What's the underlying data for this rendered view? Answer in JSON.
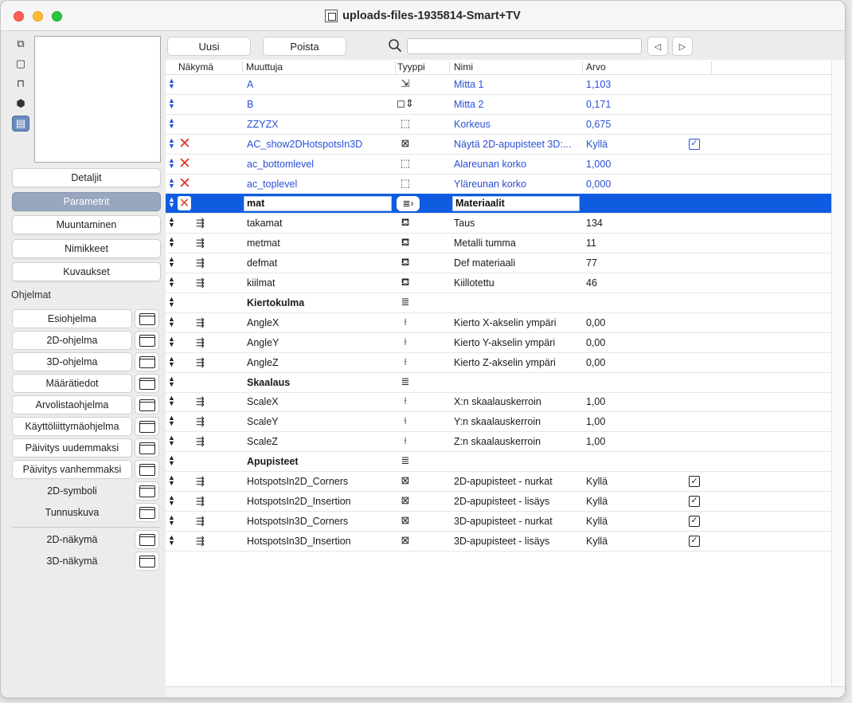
{
  "window": {
    "title": "uploads-files-1935814-Smart+TV"
  },
  "side_icons": [
    "copy-icon",
    "square-icon",
    "floor-plan-icon",
    "cube-icon",
    "list-panel-icon"
  ],
  "nav": {
    "buttons": [
      {
        "label": "Detaljit"
      },
      {
        "label": "Parametrit"
      },
      {
        "label": "Muuntaminen"
      },
      {
        "label": "Nimikkeet"
      },
      {
        "label": "Kuvaukset"
      }
    ]
  },
  "programs": {
    "label": "Ohjelmat",
    "items": [
      {
        "label": "Esiohjelma"
      },
      {
        "label": "2D-ohjelma"
      },
      {
        "label": "3D-ohjelma"
      },
      {
        "label": "Määrätiedot"
      },
      {
        "label": "Arvolistaohjelma"
      },
      {
        "label": "Käyttöliittymäohjelma"
      },
      {
        "label": "Päivitys uudemmaksi"
      },
      {
        "label": "Päivitys vanhemmaksi"
      },
      {
        "label": "2D-symboli"
      },
      {
        "label": "Tunnuskuva"
      }
    ],
    "views": [
      {
        "label": "2D-näkymä"
      },
      {
        "label": "3D-näkymä"
      }
    ]
  },
  "toolbar": {
    "new_label": "Uusi",
    "delete_label": "Poista",
    "search_placeholder": "",
    "prev_label": "◁",
    "next_label": "▷"
  },
  "table": {
    "headers": {
      "view": "Näkymä",
      "variable": "Muuttuja",
      "type": "Tyyppi",
      "name": "Nimi",
      "value": "Arvo"
    },
    "rows": [
      {
        "var": "A",
        "type_icon": "⇲",
        "name": "Mitta 1",
        "value": "1,103",
        "style": "blue"
      },
      {
        "var": "B",
        "type_icon": "◻⇕",
        "name": "Mitta 2",
        "value": "0,171",
        "style": "blue"
      },
      {
        "var": "ZZYZX",
        "type_icon": "⬚",
        "name": "Korkeus",
        "value": "0,675",
        "style": "blue"
      },
      {
        "var": "AC_show2DHotspotsIn3D",
        "type_icon": "⊠",
        "name": "Näytä 2D-apupisteet 3D:...",
        "value": "Kyllä",
        "style": "blue",
        "x": true,
        "check": "blue"
      },
      {
        "var": "ac_bottomlevel",
        "type_icon": "⬚",
        "name": "Alareunan korko",
        "value": "1,000",
        "style": "blue",
        "x": true
      },
      {
        "var": "ac_toplevel",
        "type_icon": "⬚",
        "name": "Yläreunan korko",
        "value": "0,000",
        "style": "blue",
        "x": true
      },
      {
        "var": "mat",
        "type_icon": "≣›",
        "name": "Materiaalit",
        "value": "",
        "style": "selected",
        "x": true
      },
      {
        "var": "takamat",
        "type_icon": "⛾",
        "name": "Taus",
        "value": "134",
        "style": "child"
      },
      {
        "var": "metmat",
        "type_icon": "⛾",
        "name": "Metalli tumma",
        "value": "11",
        "style": "child"
      },
      {
        "var": "defmat",
        "type_icon": "⛾",
        "name": "Def materiaali",
        "value": "77",
        "style": "child"
      },
      {
        "var": "kiilmat",
        "type_icon": "⛾",
        "name": "Kiillotettu",
        "value": "46",
        "style": "child"
      },
      {
        "var": "Kiertokulma",
        "type_icon": "≣",
        "name": "",
        "value": "",
        "style": "group"
      },
      {
        "var": "AngleX",
        "type_icon": "⟊",
        "name": "Kierto X-akselin ympäri",
        "value": "0,00",
        "style": "child"
      },
      {
        "var": "AngleY",
        "type_icon": "⟊",
        "name": "Kierto Y-akselin ympäri",
        "value": "0,00",
        "style": "child"
      },
      {
        "var": "AngleZ",
        "type_icon": "⟊",
        "name": "Kierto Z-akselin ympäri",
        "value": "0,00",
        "style": "child"
      },
      {
        "var": "Skaalaus",
        "type_icon": "≣",
        "name": "",
        "value": "",
        "style": "group"
      },
      {
        "var": "ScaleX",
        "type_icon": "⟊",
        "name": "X:n skaalauskerroin",
        "value": "1,00",
        "style": "child"
      },
      {
        "var": "ScaleY",
        "type_icon": "⟊",
        "name": "Y:n skaalauskerroin",
        "value": "1,00",
        "style": "child"
      },
      {
        "var": "ScaleZ",
        "type_icon": "⟊",
        "name": "Z:n skaalauskerroin",
        "value": "1,00",
        "style": "child"
      },
      {
        "var": "Apupisteet",
        "type_icon": "≣",
        "name": "",
        "value": "",
        "style": "group"
      },
      {
        "var": "HotspotsIn2D_Corners",
        "type_icon": "⊠",
        "name": "2D-apupisteet - nurkat",
        "value": "Kyllä",
        "style": "child",
        "check": "dark"
      },
      {
        "var": "HotspotsIn2D_Insertion",
        "type_icon": "⊠",
        "name": "2D-apupisteet - lisäys",
        "value": "Kyllä",
        "style": "child",
        "check": "dark"
      },
      {
        "var": "HotspotsIn3D_Corners",
        "type_icon": "⊠",
        "name": "3D-apupisteet - nurkat",
        "value": "Kyllä",
        "style": "child",
        "check": "dark"
      },
      {
        "var": "HotspotsIn3D_Insertion",
        "type_icon": "⊠",
        "name": "3D-apupisteet - lisäys",
        "value": "Kyllä",
        "style": "child",
        "check": "dark"
      }
    ]
  },
  "colors": {
    "selection": "#0f5ce0",
    "link_blue": "#2b4fd6",
    "delete_red": "#e23c2a",
    "active_nav": "#98a6bf"
  }
}
